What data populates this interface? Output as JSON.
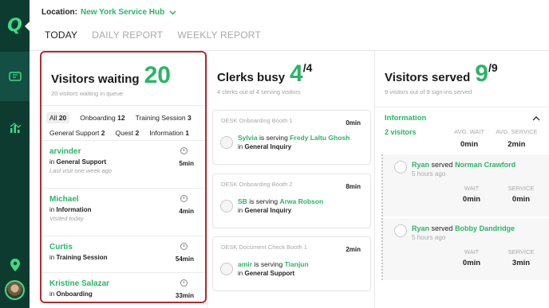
{
  "location": {
    "label": "Location:",
    "value": "New York Service Hub"
  },
  "tabs": [
    {
      "label": "TODAY"
    },
    {
      "label": "DAILY REPORT"
    },
    {
      "label": "WEEKLY REPORT"
    }
  ],
  "waiting": {
    "title": "Visitors waiting",
    "count": "20",
    "subtitle": "20 visitors waiting in queue",
    "filters": [
      {
        "label": "All",
        "count": "20"
      },
      {
        "label": "Onboarding",
        "count": "12"
      },
      {
        "label": "Training Session",
        "count": "3"
      },
      {
        "label": "General Support",
        "count": "2"
      },
      {
        "label": "Quest",
        "count": "2"
      },
      {
        "label": "Information",
        "count": "1"
      }
    ],
    "visitors": [
      {
        "name": "arvinder",
        "in": "in",
        "service": "General Support",
        "note": "Last visit one week ago",
        "minutes": "5min"
      },
      {
        "name": "Michael",
        "in": "in",
        "service": "Information",
        "note": "Visited today",
        "minutes": "4min"
      },
      {
        "name": "Curtis",
        "in": "in",
        "service": "Training Session",
        "note": "",
        "minutes": "54min"
      },
      {
        "name": "Kristine Salazar",
        "in": "in",
        "service": "Onboarding",
        "note": "",
        "minutes": "33min"
      }
    ]
  },
  "clerks": {
    "title": "Clerks busy",
    "count": "4",
    "total": "/4",
    "subtitle": "4 clerks out of 4 serving visitors",
    "desks": [
      {
        "label": "DESK Onboarding Booth 1",
        "minutes": "0min",
        "clerk": "Sylvia",
        "verb": "is serving",
        "visitor": "Fredy Laltu Ghosh",
        "in": "in",
        "service": "General Inquiry"
      },
      {
        "label": "DESK Onboarding Booth 2",
        "minutes": "8min",
        "clerk": "SB",
        "verb": "is serving",
        "visitor": "Arwa Robson",
        "in": "in",
        "service": "General Inquiry"
      },
      {
        "label": "DESK Document Check Booth 1",
        "minutes": "2min",
        "clerk": "amir",
        "verb": "is serving",
        "visitor": "Tianjun",
        "in": "in",
        "service": "General Support"
      }
    ]
  },
  "served": {
    "title": "Visitors served",
    "count": "9",
    "total": "/9",
    "subtitle": "9 visitors out of 9 sign-ins served",
    "group": {
      "name": "Information",
      "visitors": "2 visitors",
      "avg_wait_label": "AVG. WAIT",
      "avg_wait": "0min",
      "avg_service_label": "AVG. SERVICE",
      "avg_service": "2min"
    },
    "entries": [
      {
        "clerk": "Ryan",
        "verb": "served",
        "visitor": "Norman Crawford",
        "ago": "5 hours ago",
        "wait_label": "WAIT",
        "wait": "0min",
        "service_label": "SERVICE",
        "service": "0min"
      },
      {
        "clerk": "Ryan",
        "verb": "served",
        "visitor": "Bobby Dandridge",
        "ago": "5 hours ago",
        "wait_label": "WAIT",
        "wait": "0min",
        "service_label": "SERVICE",
        "service": "3min"
      }
    ]
  },
  "brand": {
    "logo_letter": "Q",
    "accent": "#2ab566",
    "rail": "#0d3b30",
    "highlight": "#b32b32"
  },
  "icons": [
    "ticket-icon",
    "analytics-icon",
    "location-pin-icon",
    "user-avatar"
  ]
}
